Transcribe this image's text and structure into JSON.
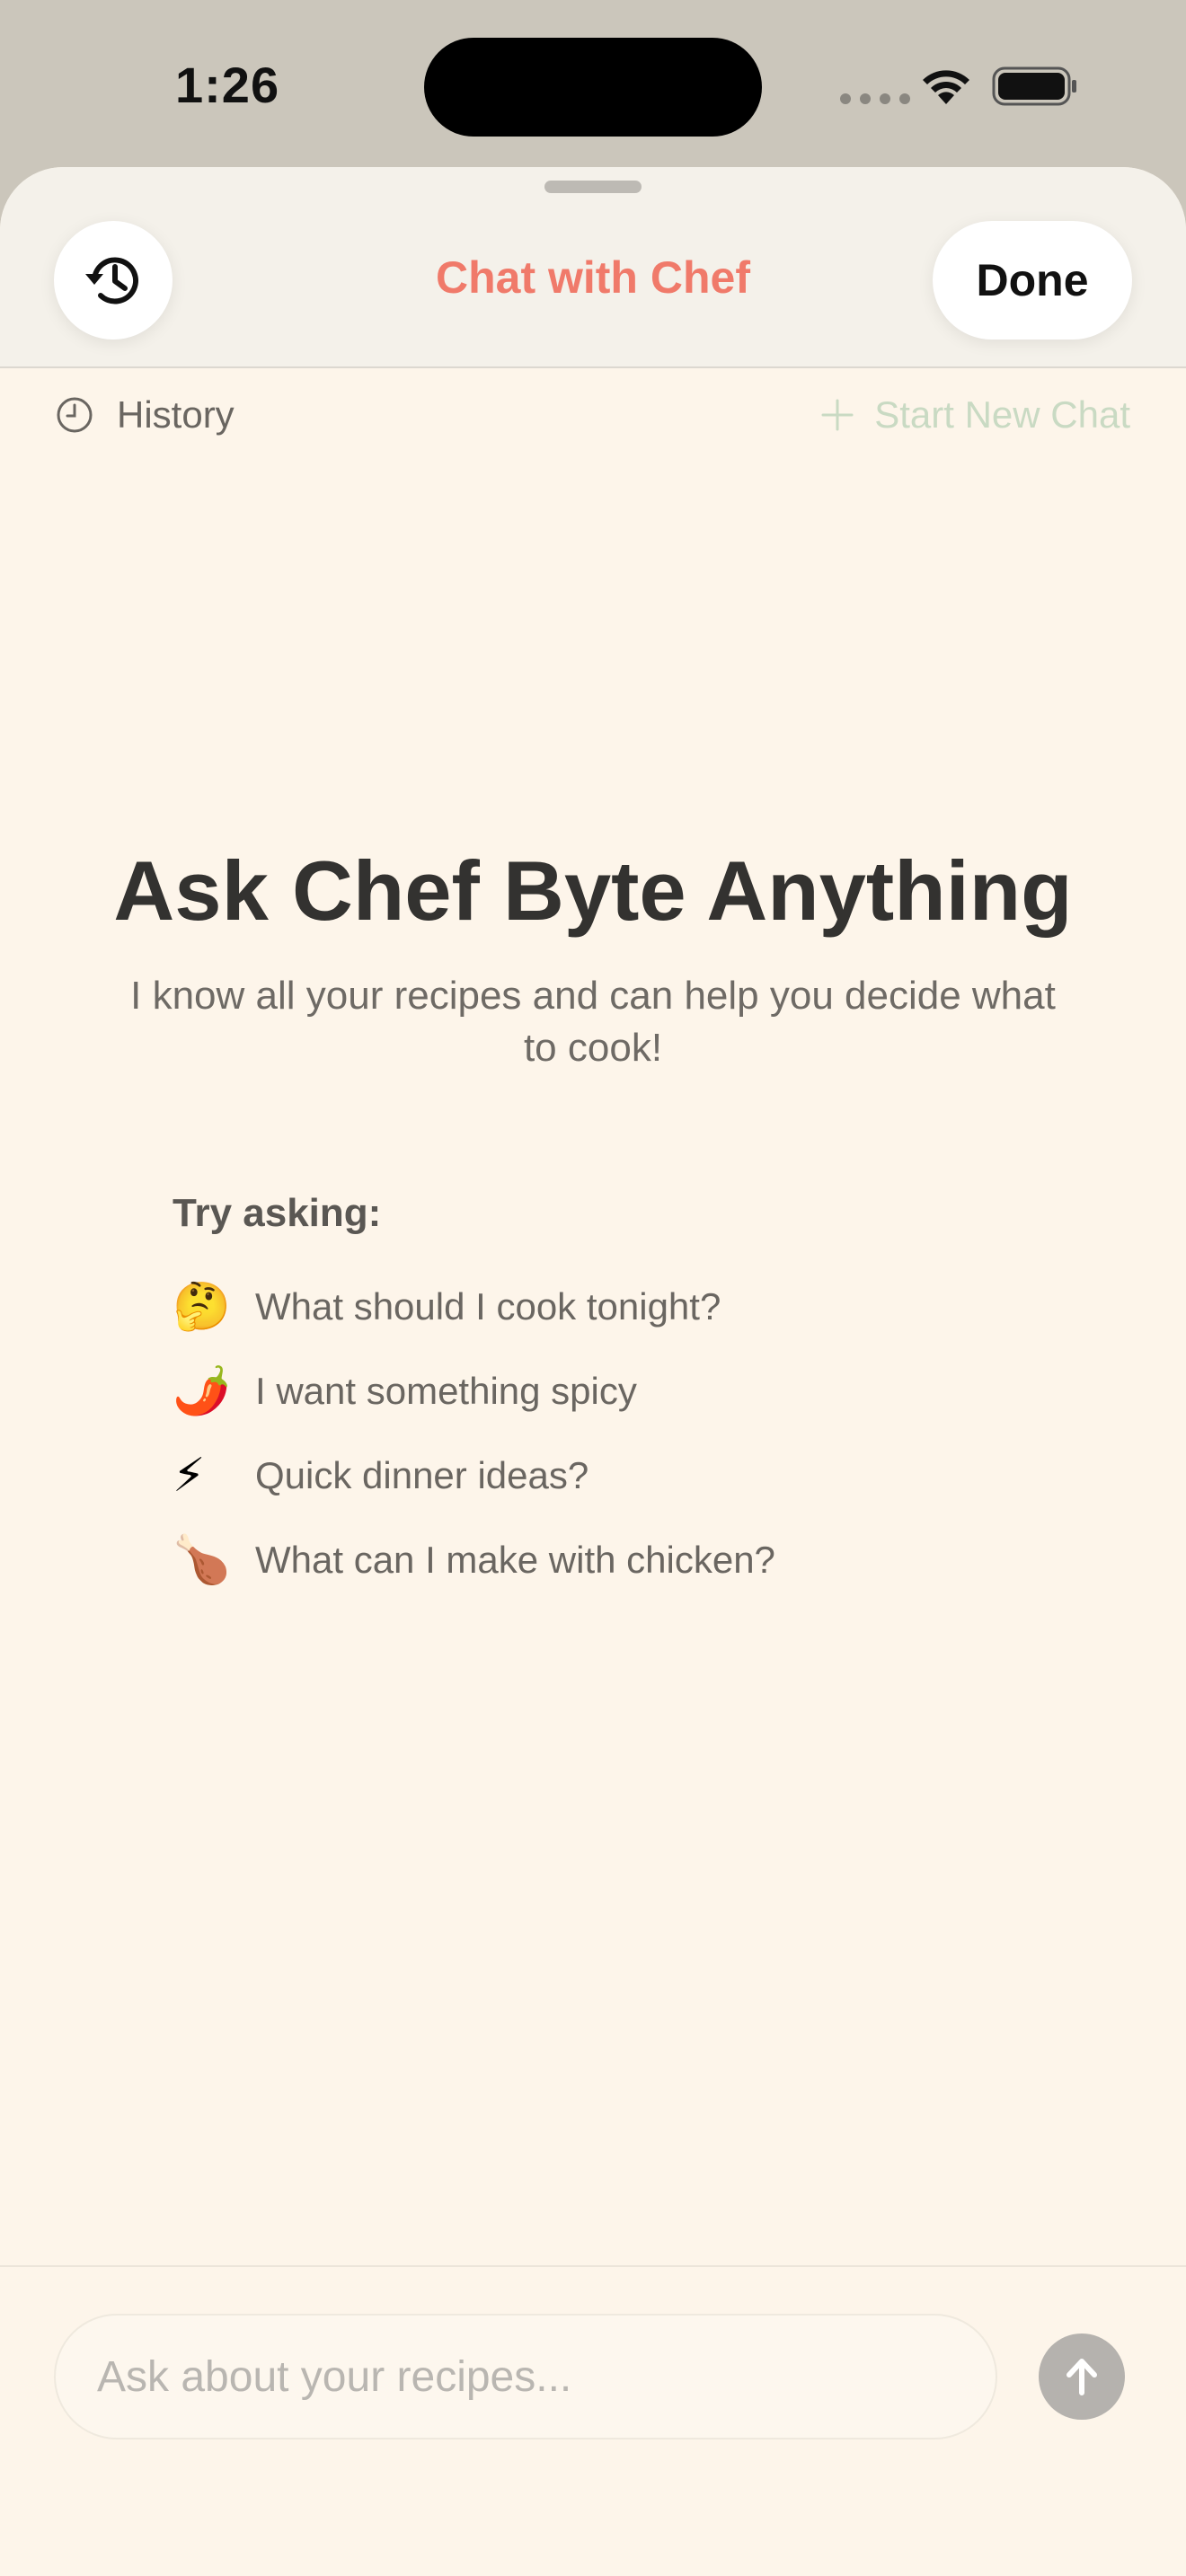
{
  "status_bar": {
    "time": "1:26"
  },
  "header": {
    "title": "Chat with Chef",
    "done_label": "Done",
    "history_icon": "clock-arrow-icon"
  },
  "toolbar": {
    "history_label": "History",
    "new_chat_label": "Start New Chat"
  },
  "empty_state": {
    "title": "Ask Chef Byte Anything",
    "subtitle": "I know all your recipes and can help you decide what to cook!",
    "try_heading": "Try asking:",
    "suggestions": [
      {
        "emoji": "🤔",
        "text": "What should I cook tonight?"
      },
      {
        "emoji": "🌶️",
        "text": "I want something spicy"
      },
      {
        "emoji": "⚡",
        "text": "Quick dinner ideas?"
      },
      {
        "emoji": "🍗",
        "text": "What can I make with chicken?"
      }
    ]
  },
  "composer": {
    "placeholder": "Ask about your recipes...",
    "value": ""
  },
  "colors": {
    "accent": "#f07a6a",
    "background": "#fdf5ea",
    "new_chat_disabled": "#c9dac3"
  }
}
